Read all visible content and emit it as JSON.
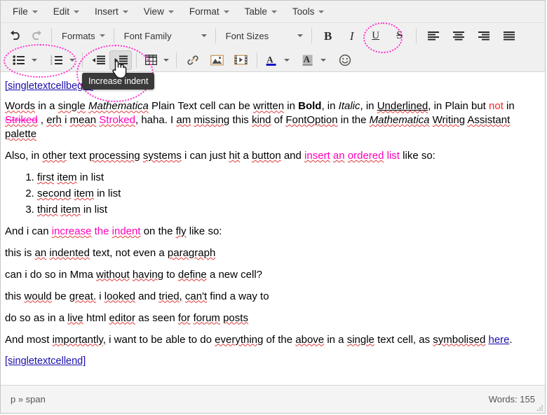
{
  "menubar": {
    "items": [
      {
        "label": "File",
        "name": "menu-file"
      },
      {
        "label": "Edit",
        "name": "menu-edit"
      },
      {
        "label": "Insert",
        "name": "menu-insert"
      },
      {
        "label": "View",
        "name": "menu-view"
      },
      {
        "label": "Format",
        "name": "menu-format"
      },
      {
        "label": "Table",
        "name": "menu-table"
      },
      {
        "label": "Tools",
        "name": "menu-tools"
      }
    ]
  },
  "toolbar_row1": {
    "undo": "undo-icon",
    "redo": "redo-icon",
    "formats_label": "Formats",
    "font_family_label": "Font Family",
    "font_sizes_label": "Font Sizes",
    "bold_glyph": "B",
    "italic_glyph": "I",
    "underline_glyph": "U",
    "strikethrough_glyph": "S",
    "align_left": "align-left-icon",
    "align_center": "align-center-icon",
    "align_right": "align-right-icon",
    "align_justify": "align-justify-icon"
  },
  "toolbar_row2": {
    "bullet_list": "bullet-list-icon",
    "numbered_list": "numbered-list-icon",
    "decrease_indent": "decrease-indent-icon",
    "increase_indent": "increase-indent-icon",
    "table": "table-icon",
    "link": "link-icon",
    "image": "image-icon",
    "media": "media-icon",
    "text_color_glyph": "A",
    "background_color_glyph": "A",
    "emoticon": "emoticon-icon"
  },
  "tooltip": {
    "text": "Increase indent"
  },
  "annotations": {
    "color": "#ff33cc",
    "targets": [
      "list-buttons",
      "indent-buttons",
      "strikethrough-button"
    ]
  },
  "document": {
    "anchor_begin": "[singletextcellbegin]",
    "anchor_end": "[singletextcellend]",
    "para1": {
      "t1": "Words in a single ",
      "mathematica1": "Mathematica",
      "t2": " Plain Text cell can be written in ",
      "bold": "Bold",
      "t3": ", in ",
      "italic": "Italic",
      "t4": ", in ",
      "underlined": "Underlined",
      "t5": ", in Plain but ",
      "not": "not",
      "t6": " in ",
      "striked": "Striked",
      "t7": " , erh i mean ",
      "stroked": "Stroked",
      "t8": ", haha. I am missing this kind of FontOption in the ",
      "mathematica2": "Mathematica",
      "t9": " Writing Assistant palette"
    },
    "para2": {
      "t1": "Also, in other text processing systems i can just hit a button and ",
      "highlight": "insert an ordered list",
      "t2": " like so:"
    },
    "list_items": [
      "first item in list",
      "second item in list",
      "third item in list"
    ],
    "para3": {
      "t1": "And i can ",
      "highlight": "increase the indent",
      "t2": " on the fly like so:"
    },
    "indented": [
      "this is an indented text, not even a paragraph",
      "can i do so in Mma without having to define a new cell?",
      "this would be great. i looked and tried, can't find a way to",
      "do so as in a live html editor as seen for forum posts"
    ],
    "para4": {
      "t1": "And most importantly, i want to be able to do everything of the above in a single text cell, as symbolised ",
      "link": "here",
      "t2": "."
    }
  },
  "statusbar": {
    "path": "p » span",
    "wordcount": "Words: 155"
  },
  "colors": {
    "magenta_text": "#ff00bb",
    "red_text": "#ff2020",
    "link_blue": "#1a0dab",
    "annotation_pink": "#ff33cc",
    "spellcheck_red": "#e03a3a",
    "toolbar_bg": "#f0f0f0"
  }
}
